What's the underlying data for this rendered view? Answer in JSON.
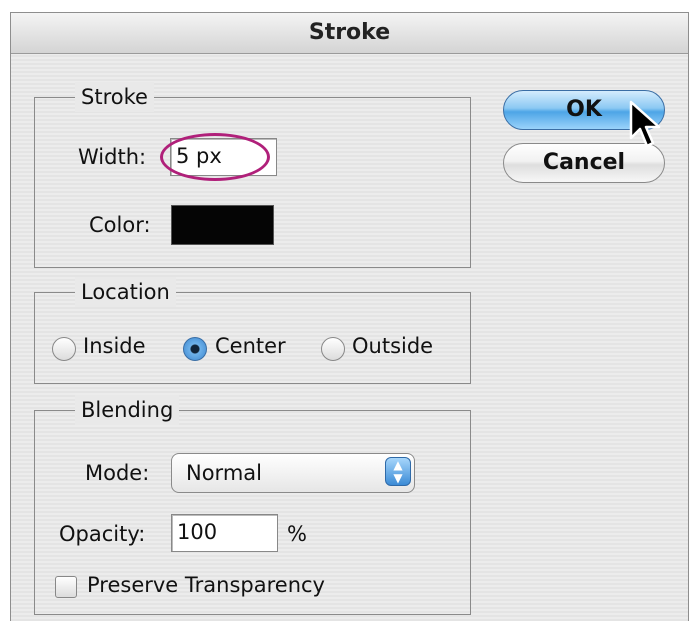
{
  "window": {
    "title": "Stroke"
  },
  "stroke": {
    "legend": "Stroke",
    "width_label": "Width:",
    "width_value": "5 px",
    "color_label": "Color:",
    "color_value": "#050505"
  },
  "location": {
    "legend": "Location",
    "options": [
      {
        "label": "Inside",
        "selected": false
      },
      {
        "label": "Center",
        "selected": true
      },
      {
        "label": "Outside",
        "selected": false
      }
    ]
  },
  "blending": {
    "legend": "Blending",
    "mode_label": "Mode:",
    "mode_value": "Normal",
    "opacity_label": "Opacity:",
    "opacity_value": "100",
    "opacity_unit": "%",
    "preserve_label": "Preserve Transparency",
    "preserve_checked": false
  },
  "buttons": {
    "ok": "OK",
    "cancel": "Cancel"
  },
  "colors": {
    "highlight": "#b0207a",
    "ok_button": "#4da5e6"
  },
  "icons": {
    "pointer": "arrow-cursor-icon",
    "select_arrows": "up-down-arrows-icon"
  }
}
